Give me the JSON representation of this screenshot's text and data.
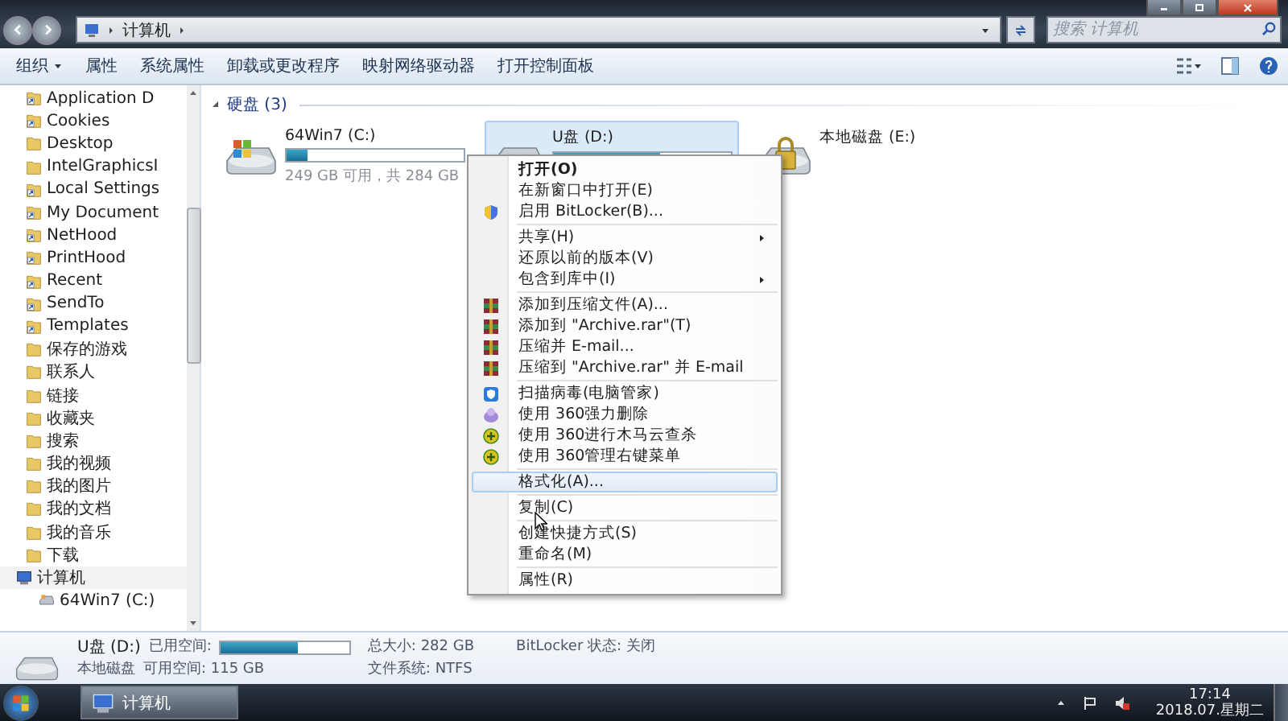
{
  "address_bar": {
    "path": [
      "计算机"
    ]
  },
  "search": {
    "placeholder": "搜索 计算机"
  },
  "toolbar": {
    "items": [
      {
        "label": "组织",
        "dropdown": true
      },
      {
        "label": "属性",
        "dropdown": false
      },
      {
        "label": "系统属性",
        "dropdown": false
      },
      {
        "label": "卸载或更改程序",
        "dropdown": false
      },
      {
        "label": "映射网络驱动器",
        "dropdown": false
      },
      {
        "label": "打开控制面板",
        "dropdown": false
      }
    ]
  },
  "sidebar": {
    "folders": [
      {
        "label": "Application D",
        "kind": "shortcut"
      },
      {
        "label": "Cookies",
        "kind": "shortcut"
      },
      {
        "label": "Desktop",
        "kind": "folder"
      },
      {
        "label": "IntelGraphicsI",
        "kind": "folder"
      },
      {
        "label": "Local Settings",
        "kind": "shortcut"
      },
      {
        "label": "My Document",
        "kind": "shortcut"
      },
      {
        "label": "NetHood",
        "kind": "shortcut"
      },
      {
        "label": "PrintHood",
        "kind": "shortcut"
      },
      {
        "label": "Recent",
        "kind": "shortcut"
      },
      {
        "label": "SendTo",
        "kind": "shortcut"
      },
      {
        "label": "Templates",
        "kind": "shortcut"
      },
      {
        "label": "保存的游戏",
        "kind": "folder"
      },
      {
        "label": "联系人",
        "kind": "folder"
      },
      {
        "label": "链接",
        "kind": "folder"
      },
      {
        "label": "收藏夹",
        "kind": "folder"
      },
      {
        "label": "搜索",
        "kind": "folder"
      },
      {
        "label": "我的视频",
        "kind": "folder"
      },
      {
        "label": "我的图片",
        "kind": "folder"
      },
      {
        "label": "我的文档",
        "kind": "folder"
      },
      {
        "label": "我的音乐",
        "kind": "folder"
      },
      {
        "label": "下载",
        "kind": "folder"
      }
    ],
    "tree": [
      {
        "label": "计算机",
        "kind": "computer",
        "children": [
          {
            "label": "64Win7  (C:)",
            "kind": "drive"
          }
        ]
      }
    ]
  },
  "content": {
    "group": {
      "label": "硬盘 (3)",
      "expanded": true
    },
    "drives": [
      {
        "name": "64Win7  (C:)",
        "kind": "system",
        "level": 0.12,
        "info": "249 GB 可用，共 284 GB",
        "selected": false
      },
      {
        "name": "U盘  (D:)",
        "kind": "disk",
        "level": 0.6,
        "selected": true
      },
      {
        "name": "本地磁盘 (E:)",
        "kind": "locked",
        "selected": false
      }
    ]
  },
  "context_menu": {
    "groups": [
      {
        "items": [
          {
            "label": "打开(O)",
            "kind": "none",
            "default": true,
            "submenu": false,
            "selected": false
          },
          {
            "label": "在新窗口中打开(E)",
            "kind": "none",
            "default": false,
            "submenu": false,
            "selected": false
          },
          {
            "label": "启用 BitLocker(B)...",
            "kind": "shield",
            "default": false,
            "submenu": false,
            "selected": false
          }
        ]
      },
      {
        "items": [
          {
            "label": "共享(H)",
            "kind": "none",
            "default": false,
            "submenu": true,
            "selected": false
          },
          {
            "label": "还原以前的版本(V)",
            "kind": "none",
            "default": false,
            "submenu": false,
            "selected": false
          },
          {
            "label": "包含到库中(I)",
            "kind": "none",
            "default": false,
            "submenu": true,
            "selected": false
          }
        ]
      },
      {
        "items": [
          {
            "label": "添加到压缩文件(A)...",
            "kind": "archive",
            "default": false,
            "submenu": false,
            "selected": false
          },
          {
            "label": "添加到 \"Archive.rar\"(T)",
            "kind": "archive",
            "default": false,
            "submenu": false,
            "selected": false
          },
          {
            "label": "压缩并 E-mail...",
            "kind": "archive",
            "default": false,
            "submenu": false,
            "selected": false
          },
          {
            "label": "压缩到 \"Archive.rar\" 并 E-mail",
            "kind": "archive",
            "default": false,
            "submenu": false,
            "selected": false
          }
        ]
      },
      {
        "items": [
          {
            "label": "扫描病毒(电脑管家)",
            "kind": "scan",
            "default": false,
            "submenu": false,
            "selected": false
          },
          {
            "label": "使用 360强力删除",
            "kind": "eraser",
            "default": false,
            "submenu": false,
            "selected": false
          },
          {
            "label": "使用 360进行木马云查杀",
            "kind": "guard",
            "default": false,
            "submenu": false,
            "selected": false
          },
          {
            "label": "使用 360管理右键菜单",
            "kind": "guard",
            "default": false,
            "submenu": false,
            "selected": false
          }
        ]
      },
      {
        "items": [
          {
            "label": "格式化(A)...",
            "kind": "none",
            "default": false,
            "submenu": false,
            "selected": true
          }
        ]
      },
      {
        "items": [
          {
            "label": "复制(C)",
            "kind": "none",
            "default": false,
            "submenu": false,
            "selected": false
          }
        ]
      },
      {
        "items": [
          {
            "label": "创建快捷方式(S)",
            "kind": "none",
            "default": false,
            "submenu": false,
            "selected": false
          },
          {
            "label": "重命名(M)",
            "kind": "none",
            "default": false,
            "submenu": false,
            "selected": false
          }
        ]
      },
      {
        "items": [
          {
            "label": "属性(R)",
            "kind": "none",
            "default": false,
            "submenu": false,
            "selected": false
          }
        ]
      }
    ]
  },
  "details": {
    "name": "U盘  (D:)",
    "type": "本地磁盘",
    "used_label": "已用空间:",
    "level": 0.6,
    "free": "可用空间: 115 GB",
    "total": "总大小: 282 GB",
    "filesystem": "文件系统: NTFS",
    "bitlocker": "BitLocker 状态: 关闭"
  },
  "taskbar": {
    "tasks": [
      {
        "label": "计算机",
        "selected": true
      }
    ],
    "clock": {
      "time": "17:14",
      "date": "2018.07.星期二"
    }
  }
}
